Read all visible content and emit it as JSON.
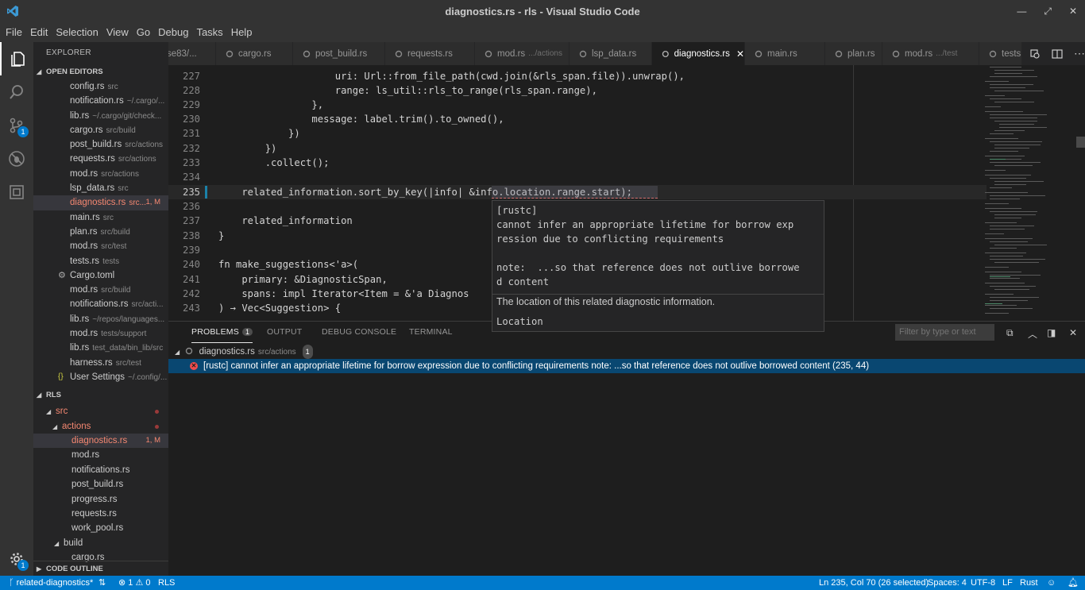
{
  "window": {
    "title": "diagnostics.rs - rls - Visual Studio Code"
  },
  "menu": [
    "File",
    "Edit",
    "Selection",
    "View",
    "Go",
    "Debug",
    "Tasks",
    "Help"
  ],
  "activity": {
    "scm_badge": "1",
    "settings_badge": "1"
  },
  "sidebar": {
    "title": "EXPLORER",
    "open_editors_header": "OPEN EDITORS",
    "open_editors": [
      {
        "name": "config.rs",
        "desc": "src"
      },
      {
        "name": "notification.rs",
        "desc": "~/.cargo/..."
      },
      {
        "name": "lib.rs",
        "desc": "~/.cargo/git/check..."
      },
      {
        "name": "cargo.rs",
        "desc": "src/build"
      },
      {
        "name": "post_build.rs",
        "desc": "src/actions"
      },
      {
        "name": "requests.rs",
        "desc": "src/actions"
      },
      {
        "name": "mod.rs",
        "desc": "src/actions"
      },
      {
        "name": "lsp_data.rs",
        "desc": "src"
      },
      {
        "name": "diagnostics.rs",
        "desc": "src...",
        "badge": "1, M"
      },
      {
        "name": "main.rs",
        "desc": "src"
      },
      {
        "name": "plan.rs",
        "desc": "src/build"
      },
      {
        "name": "mod.rs",
        "desc": "src/test"
      },
      {
        "name": "tests.rs",
        "desc": "tests"
      },
      {
        "name": "Cargo.toml",
        "desc": ""
      },
      {
        "name": "mod.rs",
        "desc": "src/build"
      },
      {
        "name": "notifications.rs",
        "desc": "src/acti..."
      },
      {
        "name": "lib.rs",
        "desc": "~/repos/languages..."
      },
      {
        "name": "mod.rs",
        "desc": "tests/support"
      },
      {
        "name": "lib.rs",
        "desc": "test_data/bin_lib/src"
      },
      {
        "name": "harness.rs",
        "desc": "src/test"
      },
      {
        "name": "User Settings",
        "desc": "~/.config/..."
      }
    ],
    "rls_header": "RLS",
    "tree": {
      "src": "src",
      "actions": "actions",
      "diagnostics": "diagnostics.rs",
      "diagnostics_badge": "1, M",
      "files": [
        "mod.rs",
        "notifications.rs",
        "post_build.rs",
        "progress.rs",
        "requests.rs",
        "work_pool.rs"
      ],
      "build": "build",
      "cargo": "cargo.rs"
    },
    "outline_header": "CODE OUTLINE"
  },
  "tabs": [
    {
      "name": "se83/...",
      "desc": ""
    },
    {
      "name": "cargo.rs",
      "desc": ""
    },
    {
      "name": "post_build.rs",
      "desc": ""
    },
    {
      "name": "requests.rs",
      "desc": ""
    },
    {
      "name": "mod.rs",
      "desc": ".../actions"
    },
    {
      "name": "lsp_data.rs",
      "desc": ""
    },
    {
      "name": "diagnostics.rs",
      "desc": ""
    },
    {
      "name": "main.rs",
      "desc": ""
    },
    {
      "name": "plan.rs",
      "desc": ""
    },
    {
      "name": "mod.rs",
      "desc": ".../test"
    },
    {
      "name": "tests",
      "desc": ""
    }
  ],
  "editor": {
    "lines": [
      {
        "n": "227",
        "text": "                    uri: Url::from_file_path(cwd.join(&rls_span.file)).unwrap(),"
      },
      {
        "n": "228",
        "text": "                    range: ls_util::rls_to_range(rls_span.range),"
      },
      {
        "n": "229",
        "text": "                },"
      },
      {
        "n": "230",
        "text": "                message: label.trim().to_owned(),"
      },
      {
        "n": "231",
        "text": "            })"
      },
      {
        "n": "232",
        "text": "        })"
      },
      {
        "n": "233",
        "text": "        .collect();"
      },
      {
        "n": "234",
        "text": ""
      },
      {
        "n": "235",
        "text": "    related_information.sort_by_key(|info| &info.location.range.start);"
      },
      {
        "n": "236",
        "text": ""
      },
      {
        "n": "237",
        "text": "    related_information"
      },
      {
        "n": "238",
        "text": "}"
      },
      {
        "n": "239",
        "text": ""
      },
      {
        "n": "240",
        "text": "fn make_suggestions<'a>("
      },
      {
        "n": "241",
        "text": "    primary: &DiagnosticSpan,"
      },
      {
        "n": "242",
        "text": "    spans: impl Iterator<Item = &'a Diagnos"
      },
      {
        "n": "243",
        "text": ") → Vec<Suggestion> {"
      }
    ]
  },
  "hover": {
    "message": "[rustc]\ncannot infer an appropriate lifetime for borrow exp\nression due to conflicting requirements\n\nnote:  ...so that reference does not outlive borrowe\nd content",
    "doc": "The location of this related diagnostic information.",
    "type": "Location"
  },
  "panel": {
    "tabs": [
      "PROBLEMS",
      "OUTPUT",
      "DEBUG CONSOLE",
      "TERMINAL"
    ],
    "problems_count": "1",
    "filter_placeholder": "Filter by type or text",
    "file": {
      "name": "diagnostics.rs",
      "path": "src/actions",
      "count": "1"
    },
    "problem": "[rustc]  cannot infer an appropriate lifetime for borrow expression due to conflicting requirements note: ...so that reference does not outlive borrowed content  (235, 44)"
  },
  "status": {
    "branch": "related-diagnostics*",
    "errors": "1",
    "warnings": "0",
    "rls": "RLS",
    "position": "Ln 235, Col 70 (26 selected)",
    "spaces": "Spaces: 4",
    "encoding": "UTF-8",
    "eol": "LF",
    "language": "Rust"
  },
  "colors": {
    "accent": "#007acc",
    "error": "#f48771",
    "selection": "#094771"
  }
}
